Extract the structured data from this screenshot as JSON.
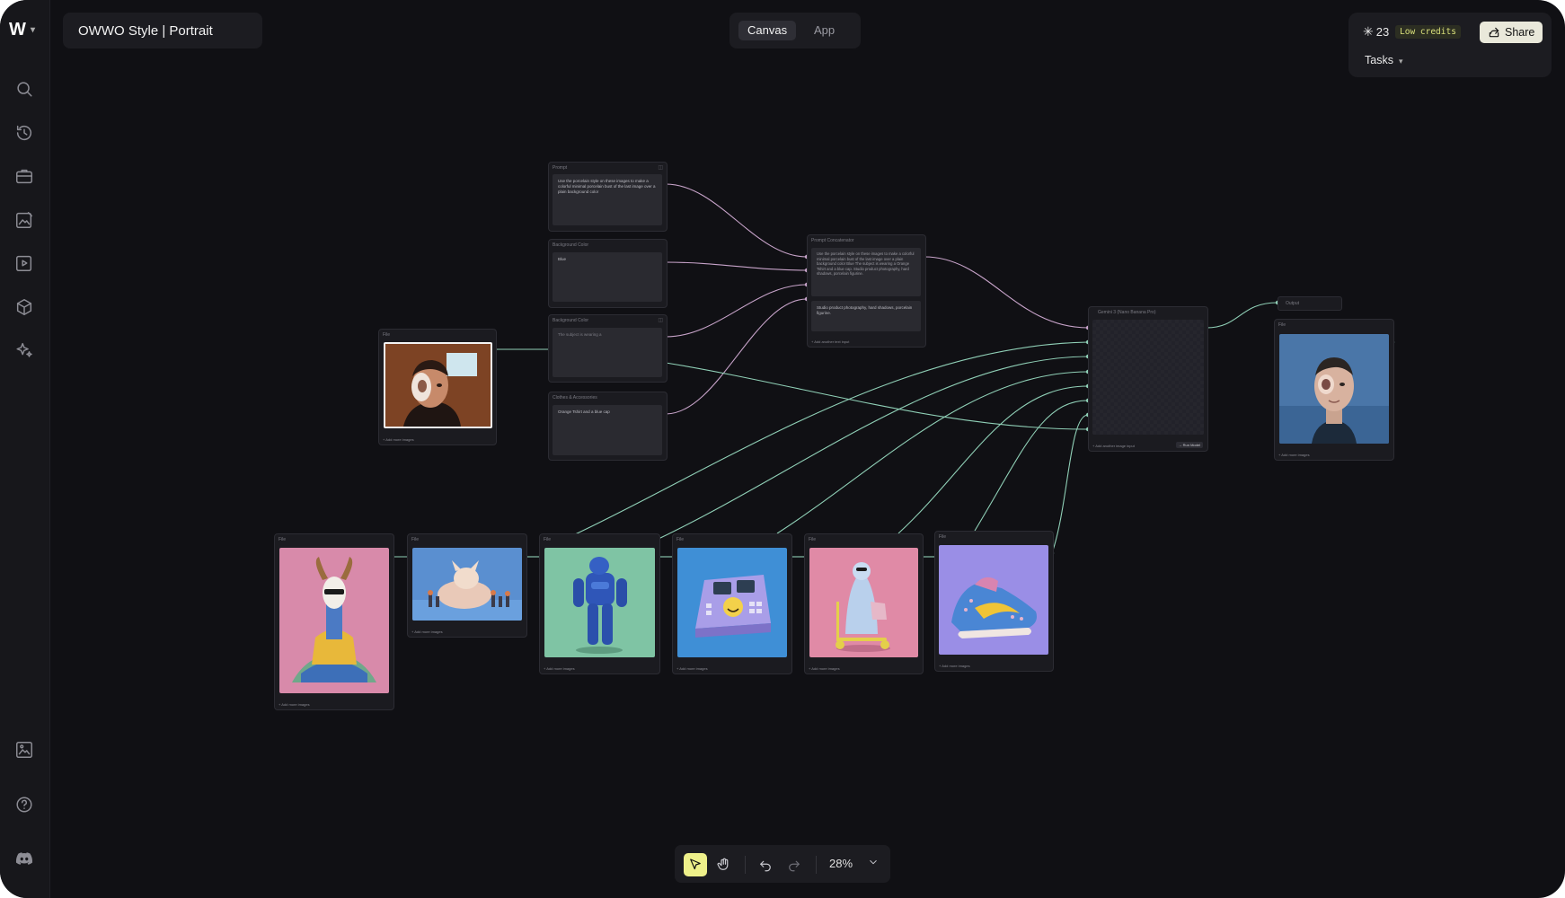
{
  "app": {
    "title": "OWWO Style | Portrait",
    "logo": "W",
    "modes": [
      {
        "label": "Canvas",
        "active": true
      },
      {
        "label": "App",
        "active": false
      }
    ]
  },
  "header": {
    "credits": "23",
    "low_credits_label": "Low credits",
    "share_label": "Share",
    "tasks_label": "Tasks"
  },
  "sidebar": {
    "icons": [
      "search-icon",
      "history-icon",
      "toolbox-icon",
      "image-edit-icon",
      "video-icon",
      "cube-icon",
      "sparkle-icon",
      "gallery-icon",
      "help-icon",
      "discord-icon"
    ]
  },
  "nodes": {
    "prompt": {
      "label": "Prompt",
      "text": "Use the porcelain style on these images to make a colorful minimal porcelain bust of the last image over a plain background color"
    },
    "bg_color_1": {
      "label": "Background Color",
      "text": "Blue"
    },
    "bg_color_2": {
      "label": "Background Color",
      "text": "The subject is wearing a"
    },
    "clothes": {
      "label": "Clothes & Accessories",
      "text": "Orange Tshirt and a blue cap"
    },
    "concat": {
      "label": "Prompt Concatenator",
      "text": "Use the porcelain style on these images to make a colorful minimal porcelain bust of the last image over a plain background color Blue The subject is wearing a Orange Tshirt and a blue cap. Studio product photography, hard shadows, porcelain figurine.",
      "text2": "Studio product photography, hard shadows, porcelain figurine.",
      "footer": "+ Add another text input"
    },
    "model": {
      "label": "Gemini 3 (Nano Banana Pro)",
      "footer": "+ Add another image input",
      "run_label": "→ Run Model"
    },
    "output": {
      "label": "Output",
      "file_label": "File",
      "footer": "+ Add more images"
    },
    "portrait_file": {
      "label": "File",
      "footer": "+ Add more images"
    },
    "files": [
      {
        "label": "File",
        "footer": "+ Add more images"
      },
      {
        "label": "File",
        "footer": "+ Add more images"
      },
      {
        "label": "File",
        "footer": "+ Add more images"
      },
      {
        "label": "File",
        "footer": "+ Add more images"
      },
      {
        "label": "File",
        "footer": "+ Add more images"
      },
      {
        "label": "File",
        "footer": "+ Add more images"
      }
    ]
  },
  "toolbar": {
    "zoom": "28%"
  },
  "colors": {
    "accent": "#eef08a",
    "wire_pink": "#c7a3c9",
    "wire_green": "#8fcfb6",
    "canvas": "#101014"
  }
}
